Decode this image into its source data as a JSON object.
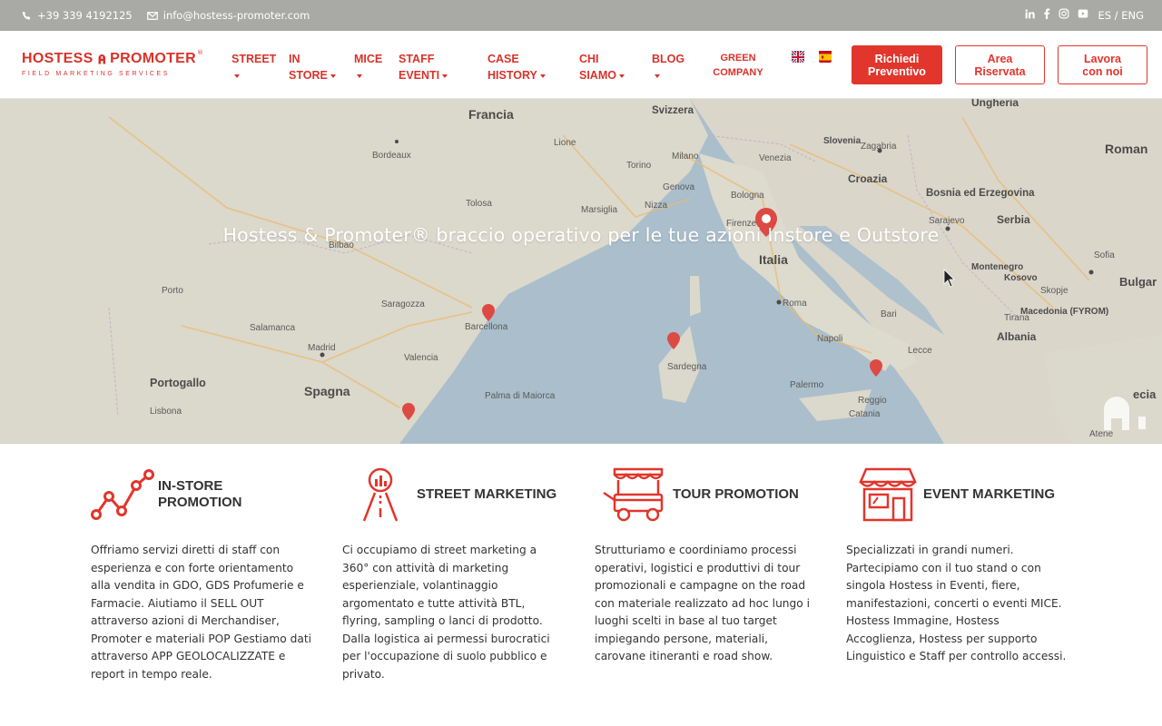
{
  "topbar": {
    "phone": "+39 339 4192125",
    "email": "info@hostess-promoter.com",
    "lang_switch": "ES / ENG",
    "social_icons": [
      "linkedin-icon",
      "facebook-icon",
      "instagram-icon",
      "youtube-icon"
    ]
  },
  "header": {
    "logo": {
      "left_word": "HOSTESS",
      "right_word": "PROMOTER",
      "sub": "FIELD MARKETING SERVICES",
      "reg": "®"
    },
    "nav": [
      {
        "line1": "STREET",
        "line2": ""
      },
      {
        "line1": "IN",
        "line2": "STORE"
      },
      {
        "line1": "MICE",
        "line2": ""
      },
      {
        "line1": "STAFF",
        "line2": "EVENTI"
      },
      {
        "line1": "CASE",
        "line2": "HISTORY"
      },
      {
        "line1": "CHI",
        "line2": "SIAMO"
      },
      {
        "line1": "BLOG",
        "line2": ""
      }
    ],
    "green": {
      "line1": "GREEN",
      "line2": "COMPANY"
    },
    "flags": [
      "uk-flag-icon",
      "spain-flag-icon"
    ],
    "buttons": {
      "quote": {
        "line1": "Richiedi",
        "line2": "Preventivo"
      },
      "reserved": {
        "line1": "Area",
        "line2": "Riservata"
      },
      "work": {
        "line1": "Lavora",
        "line2": "con noi"
      }
    }
  },
  "hero": {
    "title": "Hostess & Promoter® braccio operativo per le tue azioni Instore e Outstore",
    "map_labels": {
      "francia": "Francia",
      "svizzera": "Svizzera",
      "spagna": "Spagna",
      "italia": "Italia",
      "portogallo": "Portogallo",
      "croazia": "Croazia",
      "bosnia": "Bosnia ed Erzegovina",
      "serbia": "Serbia",
      "montenegro": "Montenegro",
      "kosovo": "Kosovo",
      "macedonia": "Macedonia (FYROM)",
      "albania": "Albania",
      "ungheria": "Ungheria",
      "slovenia": "Slovenia",
      "romania": "Roman",
      "bulgaria": "Bulgar",
      "grecia": "ecia",
      "madrid": "Madrid",
      "barcellona": "Barcellona",
      "roma": "Roma",
      "napoli": "Napoli",
      "milano": "Milano",
      "venezia": "Venezia",
      "bologna": "Bologna",
      "zagabria": "Zagabria",
      "sarajevo": "Sarajevo",
      "lione": "Lione",
      "bordeaux": "Bordeaux",
      "bilbao": "Bilbao",
      "saragozza": "Saragozza",
      "lisbona": "Lisbona",
      "palma": "Palma di Maiorca",
      "sardegna": "Sardegna",
      "tolosa": "Tolosa",
      "marsiglia": "Marsiglia",
      "salamanca": "Salamanca",
      "valencia": "Valencia",
      "porto": "Porto",
      "nizza": "Nizza",
      "torino": "Torino",
      "genova": "Genova",
      "firenze": "Firenze",
      "bari": "Bari",
      "palermo": "Palermo",
      "catania": "Catania",
      "tirana": "Tirana",
      "skopje": "Skopje",
      "sofia": "Sofia",
      "atene": "Atene",
      "reggio": "Reggio",
      "lecce": "Lecce"
    }
  },
  "services": [
    {
      "icon": "line-chart-icon",
      "title_line1": "IN-STORE",
      "title_line2": "PROMOTION",
      "desc": "Offriamo servizi diretti di staff con esperienza e con forte orientamento alla vendita in GDO, GDS Profumerie e Farmacie. Aiutiamo il SELL OUT attraverso azioni di Merchandiser, Promoter e materiali POP Gestiamo dati attraverso APP GEOLOCALIZZATE e report in tempo reale."
    },
    {
      "icon": "easel-chart-icon",
      "title_line1": "STREET MARKETING",
      "title_line2": "",
      "desc": "Ci occupiamo di street marketing a 360° con attività di marketing esperienziale, volantinaggio argomentato e tutte attività BTL, flyring, sampling o lanci di prodotto. Dalla logistica ai permessi burocratici per l'occupazione di suolo pubblico e privato."
    },
    {
      "icon": "food-cart-icon",
      "title_line1": "TOUR PROMOTION",
      "title_line2": "",
      "desc": "Strutturiamo e coordiniamo processi operativi, logistici e produttivi di tour promozionali e campagne on the road con materiale realizzato ad hoc lungo i luoghi scelti in base al tuo target impiegando persone, materiali, carovane itineranti e road show."
    },
    {
      "icon": "shop-icon",
      "title_line1": "EVENT MARKETING",
      "title_line2": "",
      "desc": "Specializzati in grandi numeri. Partecipiamo con il tuo stand o con singola Hostess in Eventi, fiere, manifestazioni, concerti o eventi MICE. Hostess Immagine, Hostess Accoglienza, Hostess per supporto Linguistico e Staff per controllo accessi."
    }
  ],
  "colors": {
    "brand_red": "#e2352b",
    "topbar_gray": "#a9aaa6"
  }
}
